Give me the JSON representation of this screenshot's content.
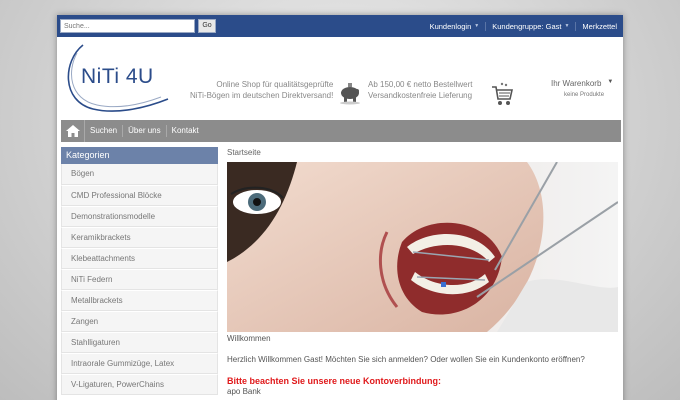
{
  "topbar": {
    "search_placeholder": "Suche...",
    "go_label": "Go",
    "links": [
      "Kundenlogin",
      "Kundengruppe: Gast",
      "Merkzettel"
    ]
  },
  "header": {
    "logo_text": "NiTi 4U",
    "slogan_line1": "Online Shop für qualitätsgeprüfte",
    "slogan_line2": "NiTi-Bögen im deutschen Direktversand!",
    "shipping_line1": "Ab 150,00 € netto Bestellwert",
    "shipping_line2": "Versandkostenfreie Lieferung",
    "cart_title": "Ihr Warenkorb",
    "cart_sub": "keine Produkte"
  },
  "nav": {
    "items": [
      "Suchen",
      "Über uns",
      "Kontakt"
    ]
  },
  "sidebar": {
    "title": "Kategorien",
    "items": [
      "Bögen",
      "CMD Professional Blöcke",
      "Demonstrationsmodelle",
      "Keramikbrackets",
      "Klebeattachments",
      "NiTi Federn",
      "Metallbrackets",
      "Zangen",
      "Stahlligaturen",
      "Intraorale Gummizüge, Latex",
      "V-Ligaturen, PowerChains"
    ]
  },
  "main": {
    "breadcrumb": "Startseite",
    "welcome_title": "Willkommen",
    "welcome_text": "Herzlich Willkommen Gast! Möchten Sie sich anmelden? Oder wollen Sie ein Kundenkonto eröffnen?",
    "notice": "Bitte beachten Sie unsere neue Kontoverbindung:",
    "bank": "apo Bank"
  },
  "colors": {
    "topbar": "#2b4c8a",
    "nav": "#8c8c8c",
    "sidebar_head": "#6c82a9",
    "notice": "#e0191b"
  }
}
